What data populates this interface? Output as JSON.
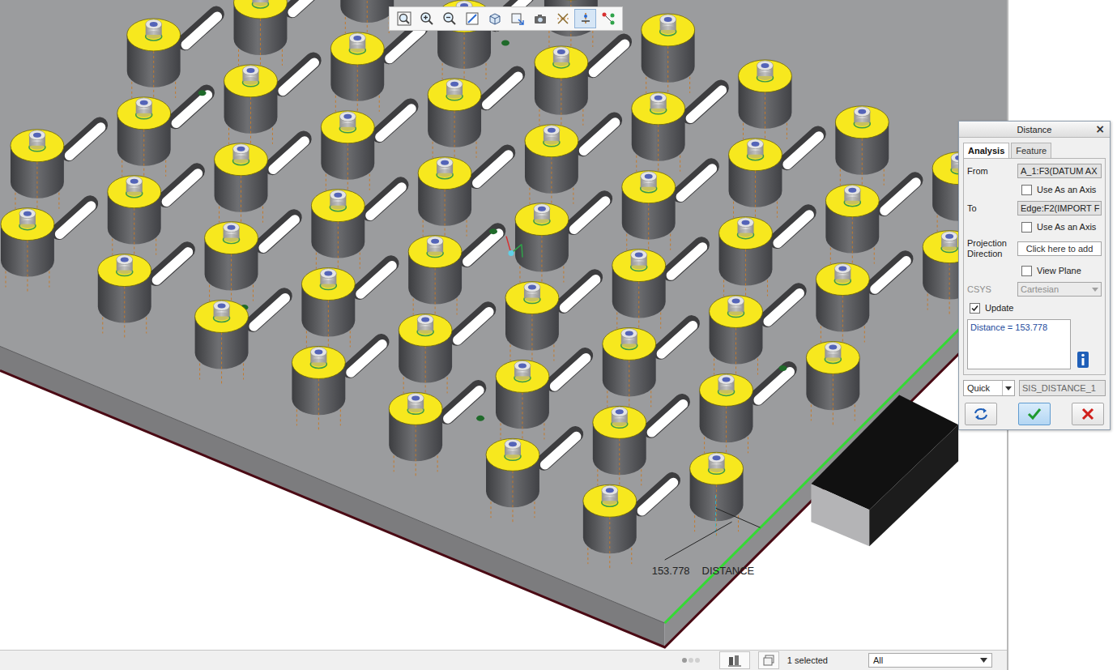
{
  "toolbar": [
    {
      "selected": false
    },
    {
      "selected": false
    },
    {
      "selected": false
    },
    {
      "selected": false
    },
    {
      "selected": false
    },
    {
      "selected": false
    },
    {
      "selected": false
    },
    {
      "selected": false
    },
    {
      "selected": true
    },
    {
      "selected": false
    }
  ],
  "scene": {
    "measurement": {
      "value": "153.778",
      "label": "DISTANCE"
    }
  },
  "dialog": {
    "title": "Distance",
    "close": "×",
    "tabs": [
      {
        "label": "Analysis",
        "selected": true
      },
      {
        "label": "Feature",
        "selected": false
      }
    ],
    "rows": [
      {
        "kind": "field",
        "label": "From",
        "value": "A_1:F3(DATUM AX"
      },
      {
        "kind": "checkbox",
        "label": "Use As an Axis",
        "checked": false
      },
      {
        "kind": "field",
        "label": "To",
        "value": "Edge:F2(IMPORT F"
      },
      {
        "kind": "checkbox",
        "label": "Use As an Axis",
        "checked": false
      },
      {
        "kind": "collector",
        "label": "Projection Direction",
        "value": "Click here to add"
      },
      {
        "kind": "checkbox",
        "label": "View Plane",
        "checked": false
      },
      {
        "kind": "select",
        "label": "CSYS",
        "value": "Cartesian",
        "disabled": true
      }
    ],
    "update": {
      "label": "Update",
      "checked": true
    },
    "result": "Distance = 153.778",
    "mode": "Quick",
    "name": "SIS_DISTANCE_1",
    "buttons": [
      {
        "kind": "repeat",
        "default": false
      },
      {
        "kind": "ok",
        "default": true
      },
      {
        "kind": "cancel",
        "default": false
      }
    ]
  },
  "status_bar": {
    "selection": "1 selected",
    "filter": "All"
  }
}
